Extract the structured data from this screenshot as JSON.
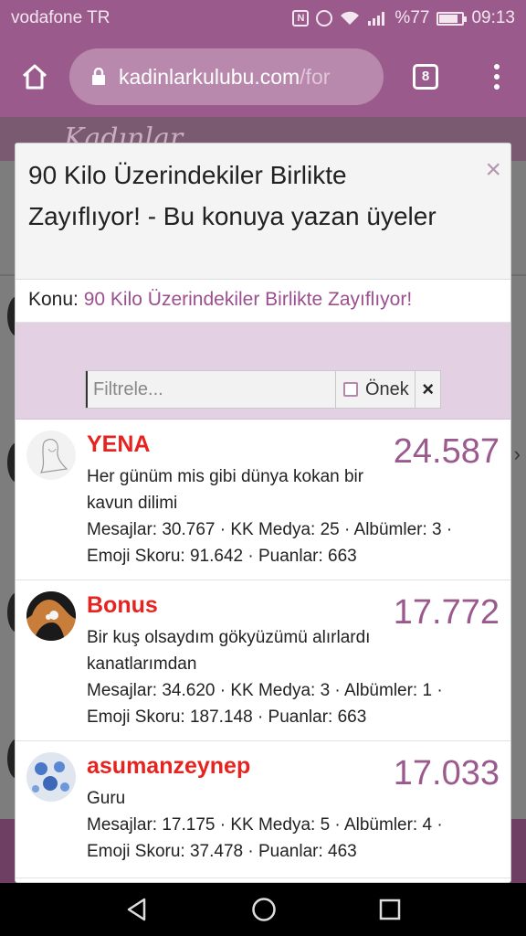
{
  "status_bar": {
    "carrier": "vodafone TR",
    "battery": "%77",
    "time": "09:13",
    "icons": [
      "nfc-icon",
      "alarm-icon",
      "wifi-icon",
      "signal-icon",
      "battery-icon"
    ]
  },
  "browser": {
    "url_domain": "kadinlarkulubu.com",
    "url_rest": "/for",
    "tab_count": "8"
  },
  "background_page": {
    "logo_text": "Kadınlar"
  },
  "modal": {
    "title": "90 Kilo Üzerindekiler Birlikte Zayıflıyor! - Bu konuya yazan üyeler",
    "close_symbol": "×",
    "topic_label": "Konu:",
    "topic_link": "90 Kilo Üzerindekiler Birlikte Zayıflıyor!",
    "filter_placeholder": "Filtrele...",
    "prefix_label": "Önek",
    "clear_symbol": "×"
  },
  "members": [
    {
      "name": "YENA",
      "title": "Her günüm mis gibi dünya kokan bir kavun dilimi",
      "stats_line1": "Mesajlar: 30.767 · KK Medya: 25 · Albümler: 3 ·",
      "stats_line2": "Emoji Skoru: 91.642 · Puanlar: 663",
      "score": "24.587"
    },
    {
      "name": "Bonus",
      "title": "Bir kuş olsaydım gökyüzümü alırlardı kanatlarımdan",
      "stats_line1": "Mesajlar: 34.620 · KK Medya: 3 · Albümler: 1 ·",
      "stats_line2": "Emoji Skoru: 187.148 · Puanlar: 663",
      "score": "17.772"
    },
    {
      "name": "asumanzeynep",
      "title": "Guru",
      "stats_line1": "Mesajlar: 17.175 · KK Medya: 5 · Albümler: 4 ·",
      "stats_line2": "Emoji Skoru: 37.478 · Puanlar: 463",
      "score": "17.033"
    }
  ],
  "colors": {
    "brand_purple": "#9a5a8c",
    "member_name_red": "#e6231f",
    "score_purple": "#9b5a8e",
    "filter_band": "#e3d0e2"
  }
}
